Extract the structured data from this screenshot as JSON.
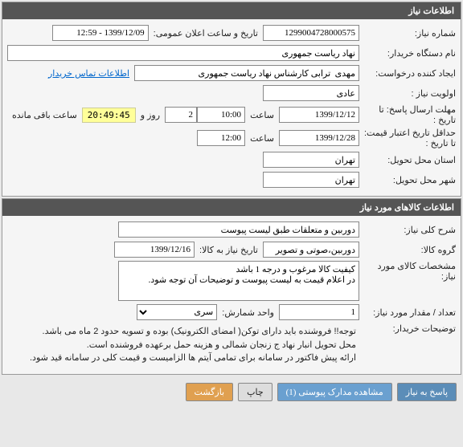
{
  "panel1": {
    "title": "اطلاعات نیاز",
    "need_number_label": "شماره نیاز:",
    "need_number": "1299004728000575",
    "announce_label": "تاریخ و ساعت اعلان عمومی:",
    "announce_value": "1399/12/09 - 12:59",
    "buyer_org_label": "نام دستگاه خریدار:",
    "buyer_org": "نهاد ریاست جمهوری",
    "requester_label": "ایجاد کننده درخواست:",
    "requester": "مهدی  ترابی کارشناس نهاد ریاست جمهوری",
    "contact_link": "اطلاعات تماس خریدار",
    "priority_label": "اولویت نیاز :",
    "priority": "عادی",
    "deadline_label": "مهلت ارسال پاسخ:",
    "until_label": "تا تاریخ :",
    "deadline_date": "1399/12/12",
    "hour_label": "ساعت",
    "deadline_time": "10:00",
    "days_remain": "2",
    "days_label": "روز و",
    "countdown": "20:49:45",
    "remain_label": "ساعت باقی مانده",
    "price_valid_label": "حداقل تاریخ اعتبار قیمت:",
    "price_valid_date": "1399/12/28",
    "price_valid_time": "12:00",
    "delivery_province_label": "استان محل تحویل:",
    "delivery_province": "تهران",
    "delivery_city_label": "شهر محل تحویل:",
    "delivery_city": "تهران"
  },
  "panel2": {
    "title": "اطلاعات کالاهای مورد نیاز",
    "main_desc_label": "شرح کلی نیاز:",
    "main_desc": "دوربین و متعلقات طبق لیست پیوست",
    "group_label": "گروه کالا:",
    "group": "دوربین،صوتی و تصویر",
    "need_date_label": "تاریخ نیاز به کالا:",
    "need_date": "1399/12/16",
    "spec_label": "مشخصات کالای مورد نیاز:",
    "spec": "کیفیت کالا مرغوب و درجه 1 باشد\nدر اعلام قیمت به لیست پیوست و توضیحات آن توجه شود.",
    "qty_label": "تعداد / مقدار مورد نیاز:",
    "qty": "1",
    "unit_label": "واحد شمارش:",
    "unit": "سری",
    "buyer_notes_label": "توضیحات خریدار:",
    "buyer_notes": "توجه!! فروشنده باید دارای توکن( امضای الکترونیک) بوده و تسویه حدود 2 ماه می باشد.\nمحل تحویل انبار نهاد ج زنجان شمالی و هزینه حمل برعهده فروشنده است.\nارائه پیش فاکتور در سامانه برای تمامی آیتم ها الزامیست و قیمت کلی در سامانه قید شود."
  },
  "buttons": {
    "respond": "پاسخ به نیاز",
    "attachments": "مشاهده مدارک پیوستی (1)",
    "print": "چاپ",
    "back": "بازگشت"
  }
}
